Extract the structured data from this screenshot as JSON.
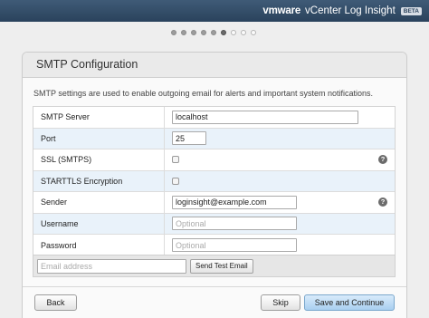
{
  "header": {
    "brand": "vmware",
    "product": "vCenter Log Insight",
    "badge": "BETA"
  },
  "wizard": {
    "steps_total": 9,
    "current_step": 6,
    "steps_completed": 5
  },
  "page": {
    "title": "SMTP Configuration",
    "description": "SMTP settings are used to enable outgoing email for alerts and important system notifications."
  },
  "form": {
    "smtp_server_label": "SMTP Server",
    "smtp_server_value": "localhost",
    "port_label": "Port",
    "port_value": "25",
    "ssl_label": "SSL (SMTPS)",
    "ssl_checked": false,
    "starttls_label": "STARTTLS Encryption",
    "starttls_checked": false,
    "sender_label": "Sender",
    "sender_value": "loginsight@example.com",
    "username_label": "Username",
    "username_placeholder": "Optional",
    "password_label": "Password",
    "password_placeholder": "Optional",
    "help_glyph": "?"
  },
  "test": {
    "email_placeholder": "Email address",
    "button_label": "Send Test Email"
  },
  "footer": {
    "back_label": "Back",
    "skip_label": "Skip",
    "save_label": "Save and Continue"
  },
  "colors": {
    "topbar": "#2f4a66",
    "alt_row": "#e9f2fa",
    "primary_button": "#b7d8f3"
  }
}
